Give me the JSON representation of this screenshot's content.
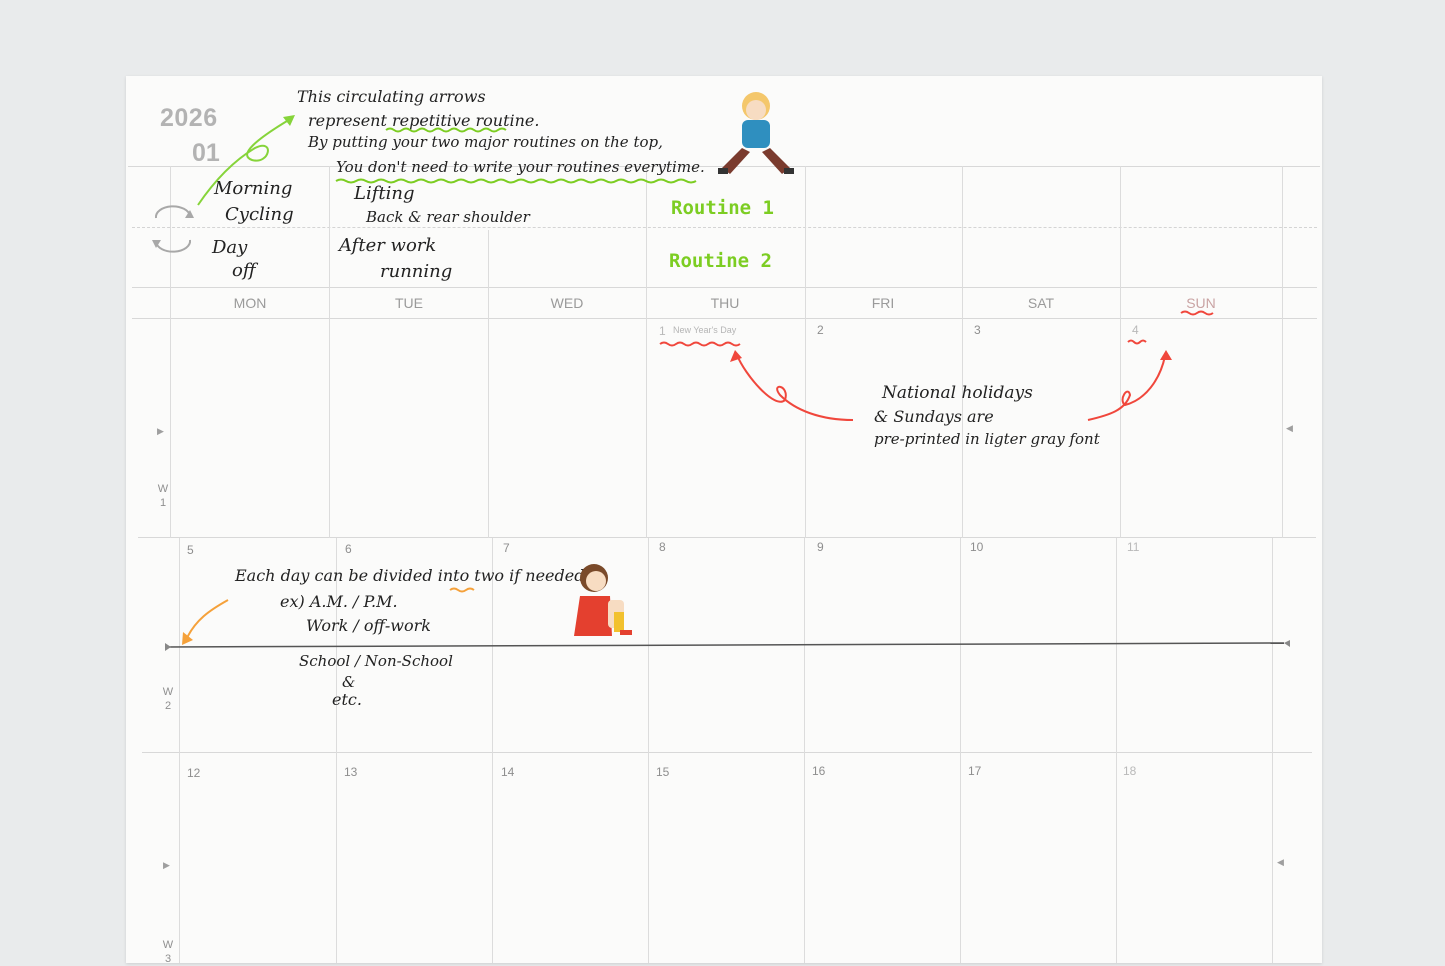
{
  "header": {
    "year": "2026",
    "month": "01"
  },
  "weekdays": [
    "MON",
    "TUE",
    "WED",
    "THU",
    "FRI",
    "SAT",
    "SUN"
  ],
  "weeks": [
    {
      "label": "W\n1",
      "dates": [
        "",
        "",
        "",
        "1",
        "2",
        "3",
        "4"
      ]
    },
    {
      "label": "W\n2",
      "dates": [
        "5",
        "6",
        "7",
        "8",
        "9",
        "10",
        "11"
      ]
    },
    {
      "label": "W\n3",
      "dates": [
        "12",
        "13",
        "14",
        "15",
        "16",
        "17",
        "18"
      ]
    }
  ],
  "holiday": {
    "name": "New Year's Day"
  },
  "notes": {
    "intro": [
      "This circulating arrows",
      "represent repetitive routine.",
      "By putting your two major routines on the top,",
      "You don't need to write your routines everytime."
    ],
    "routine1_label": "Routine 1",
    "routine2_label": "Routine 2",
    "mon_r1_a": "Morning",
    "mon_r1_b": "Cycling",
    "mon_r2_a": "Day",
    "mon_r2_b": "off",
    "tue_r1_a": "Lifting",
    "tue_r1_b": "Back & rear shoulder",
    "tue_r2_a": "After work",
    "tue_r2_b": "running",
    "holiday_note": [
      "National holidays",
      "& Sundays are",
      "pre-printed in ligter gray font"
    ],
    "divide_note": [
      "Each day can be divided into two if needed",
      "ex) A.M. / P.M.",
      "Work / off-work",
      "School / Non-School",
      "&",
      "etc."
    ]
  },
  "colors": {
    "accent_green": "#7ccd22",
    "accent_red": "#f0473c",
    "accent_orange": "#f5a13a"
  }
}
